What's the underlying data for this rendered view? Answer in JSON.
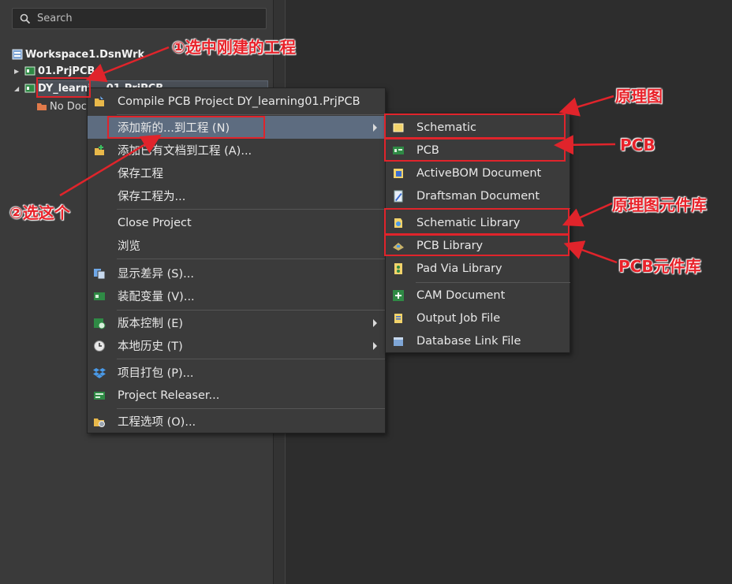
{
  "search": {
    "placeholder": "Search"
  },
  "tree": {
    "workspace": "Workspace1.DsnWrk",
    "project1": "01.PrjPCB",
    "project2": "DY_learni",
    "project2_tail": "...01.PrjPCB",
    "no_docs": "No Doc"
  },
  "menu": {
    "compile": "Compile PCB Project DY_learning01.PrjPCB",
    "add_new": "添加新的...到工程 (N)",
    "add_existing": "添加已有文档到工程 (A)...",
    "save_project": "保存工程",
    "save_project_as": "保存工程为...",
    "close_project": "Close Project",
    "browse": "浏览",
    "show_diff": "显示差异 (S)...",
    "variants": "装配变量 (V)...",
    "version_control": "版本控制 (E)",
    "local_history": "本地历史 (T)",
    "packager": "项目打包 (P)...",
    "releaser": "Project Releaser...",
    "options": "工程选项 (O)..."
  },
  "submenu": {
    "schematic": "Schematic",
    "pcb": "PCB",
    "activebom": "ActiveBOM Document",
    "draftsman": "Draftsman Document",
    "schematic_library": "Schematic Library",
    "pcb_library": "PCB Library",
    "pad_via_library": "Pad Via Library",
    "cam_document": "CAM Document",
    "output_job": "Output Job File",
    "database_link": "Database Link File"
  },
  "annotations": {
    "step1": "①选中刚建的工程",
    "step2": "②选这个",
    "schematic_note": "原理图",
    "pcb_note": "PCB",
    "schlib_note": "原理图元件库",
    "pcblib_note": "PCB元件库"
  },
  "colors": {
    "annotation": "#e0242b",
    "menu_active": "#5d6c80",
    "menu_bg": "#3b3b3b"
  }
}
